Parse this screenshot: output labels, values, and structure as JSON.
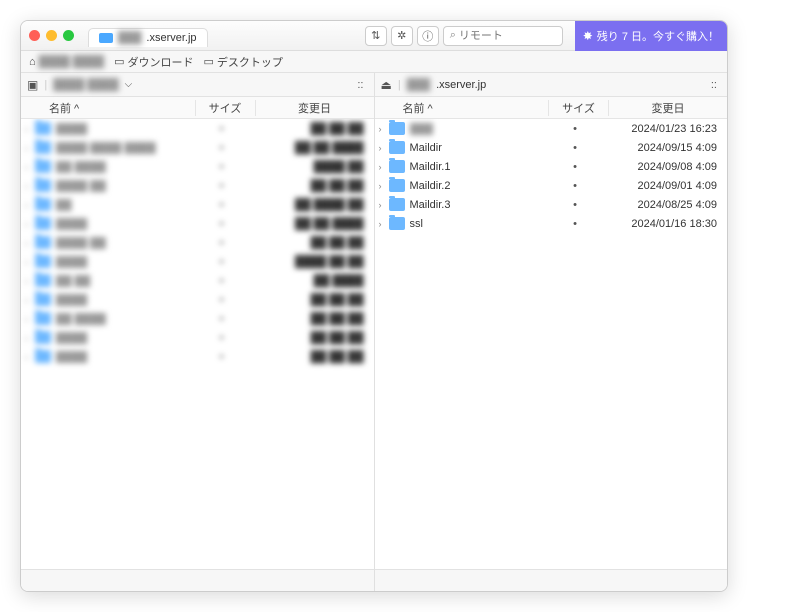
{
  "titlebar": {
    "tab_label": ".xserver.jp",
    "tool_updown": "⇅",
    "tool_sync": "✲",
    "tool_info": "ⓘ",
    "search_placeholder": "リモート",
    "promo_text": "残り 7 日。今すぐ購入！"
  },
  "breadcrumb": {
    "home": "",
    "downloads": "ダウンロード",
    "desktop": "デスクトップ"
  },
  "left": {
    "volume": "",
    "dropdown": "⌵",
    "view": "::",
    "cols": {
      "name": "名前 ^",
      "size": "サイズ",
      "date": "変更日"
    },
    "rows": [
      {
        "n": "████",
        "s": "•",
        "d": "██ ██ ██"
      },
      {
        "n": "████  ████ ████",
        "s": "•",
        "d": "██ ██ ████"
      },
      {
        "n": "██ ████",
        "s": "•",
        "d": "████ ██"
      },
      {
        "n": "████ ██",
        "s": "•",
        "d": "██ ██ ██"
      },
      {
        "n": "██",
        "s": "•",
        "d": "██ ████ ██"
      },
      {
        "n": "████",
        "s": "•",
        "d": "██ ██ ████"
      },
      {
        "n": "████ ██",
        "s": "•",
        "d": "██ ██ ██"
      },
      {
        "n": "████",
        "s": "•",
        "d": "████ ██ ██"
      },
      {
        "n": "██ ██",
        "s": "•",
        "d": "██ ████"
      },
      {
        "n": "████",
        "s": "•",
        "d": "██ ██ ██"
      },
      {
        "n": "██ ████",
        "s": "•",
        "d": "██ ██ ██"
      },
      {
        "n": "████",
        "s": "•",
        "d": "██ ██ ██"
      },
      {
        "n": "████",
        "s": "•",
        "d": "██ ██ ██"
      }
    ]
  },
  "right": {
    "volume": ".xserver.jp",
    "view": "::",
    "cols": {
      "name": "名前 ^",
      "size": "サイズ",
      "date": "変更日"
    },
    "rows": [
      {
        "n": "███",
        "s": "•",
        "d": "2024/01/23 16:23"
      },
      {
        "n": "Maildir",
        "s": "•",
        "d": "2024/09/15 4:09"
      },
      {
        "n": "Maildir.1",
        "s": "•",
        "d": "2024/09/08 4:09"
      },
      {
        "n": "Maildir.2",
        "s": "•",
        "d": "2024/09/01 4:09"
      },
      {
        "n": "Maildir.3",
        "s": "•",
        "d": "2024/08/25 4:09"
      },
      {
        "n": "ssl",
        "s": "•",
        "d": "2024/01/16 18:30"
      }
    ]
  }
}
